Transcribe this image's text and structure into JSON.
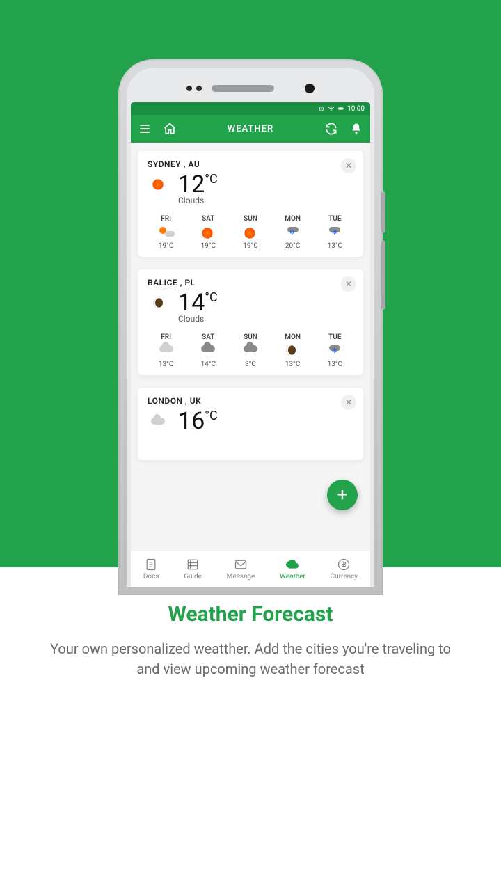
{
  "status": {
    "time": "10:00"
  },
  "appbar": {
    "title": "WEATHER"
  },
  "nav": {
    "items": [
      {
        "label": "Docs"
      },
      {
        "label": "Guide"
      },
      {
        "label": "Message"
      },
      {
        "label": "Weather"
      },
      {
        "label": "Currency"
      }
    ],
    "active_index": 3
  },
  "cards": [
    {
      "city": "SYDNEY , AU",
      "icon": "sun",
      "temp": "12",
      "unit": "°C",
      "cond": "Clouds",
      "days": [
        {
          "label": "FRI",
          "icon": "suncloud",
          "temp": "19°C"
        },
        {
          "label": "SAT",
          "icon": "sun",
          "temp": "19°C"
        },
        {
          "label": "SUN",
          "icon": "sun",
          "temp": "19°C"
        },
        {
          "label": "MON",
          "icon": "rain",
          "temp": "20°C"
        },
        {
          "label": "TUE",
          "icon": "rain",
          "temp": "13°C"
        }
      ]
    },
    {
      "city": "BALICE , PL",
      "icon": "moon",
      "temp": "14",
      "unit": "°C",
      "cond": "Clouds",
      "days": [
        {
          "label": "FRI",
          "icon": "cloud",
          "temp": "13°C"
        },
        {
          "label": "SAT",
          "icon": "cloud-dark",
          "temp": "14°C"
        },
        {
          "label": "SUN",
          "icon": "cloud-dark",
          "temp": "8°C"
        },
        {
          "label": "MON",
          "icon": "moon",
          "temp": "13°C"
        },
        {
          "label": "TUE",
          "icon": "rain",
          "temp": "13°C"
        }
      ]
    },
    {
      "city": "LONDON , UK",
      "icon": "cloud",
      "temp": "16",
      "unit": "°C",
      "cond": "",
      "partial": true,
      "days": []
    }
  ],
  "fab": "+",
  "promo": {
    "title": "Weather Forecast",
    "body": "Your own personalized weatther. Add the cities you're traveling to and view upcoming weather forecast"
  }
}
